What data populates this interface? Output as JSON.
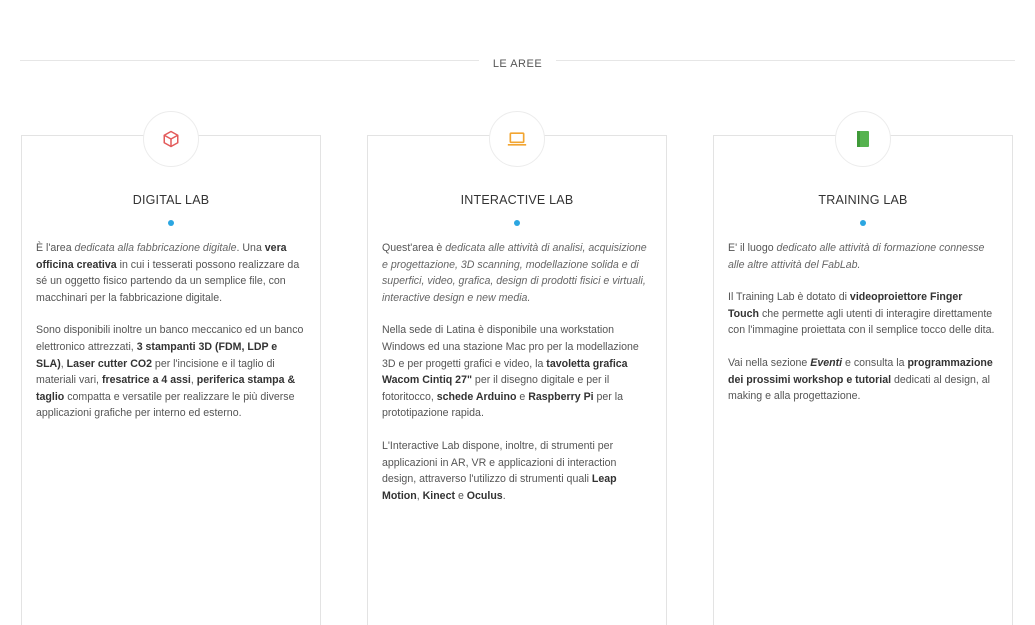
{
  "section": {
    "title": "LE AREE"
  },
  "colors": {
    "accent": "#2ba6e1",
    "cube_icon": "#e35a5a",
    "laptop_icon": "#f2a531",
    "book_icon": "#56b34f"
  },
  "cards": [
    {
      "icon": "cube-icon",
      "title": "DIGITAL LAB",
      "p1": {
        "s1": "È l'area ",
        "em1": "dedicata alla fabbricazione digitale",
        "s2": ". Una ",
        "b1": "vera officina creativa",
        "s3": " in cui i tesserati possono realizzare da sé un oggetto fisico partendo da un semplice file, con macchinari per la fabbricazione digitale."
      },
      "p2": {
        "s1": "Sono disponibili inoltre un banco meccanico ed un banco elettronico attrezzati, ",
        "b1": "3 stampanti 3D (FDM, LDP e SLA)",
        "s2": ", ",
        "b2": "Laser cutter CO2",
        "s3": " per l'incisione e il taglio di materiali vari, ",
        "b3": "fresatrice a 4 assi",
        "s4": ", ",
        "b4": "periferica stampa & taglio",
        "s5": " compatta e versatile per realizzare le più diverse applicazioni grafiche per interno ed esterno."
      }
    },
    {
      "icon": "laptop-icon",
      "title": "INTERACTIVE LAB",
      "p1": {
        "s1": "Quest'area è ",
        "em1": "dedicata alle attività di analisi, acquisizione e progettazione, 3D scanning, modellazione solida e di superfici, video, grafica, design di prodotti fisici e virtuali, interactive design e new media."
      },
      "p2": {
        "s1": "Nella sede di Latina è disponibile una workstation Windows ed una stazione Mac pro per la modellazione 3D e per progetti grafici e video, la ",
        "b1": "tavoletta grafica Wacom Cintiq 27\"",
        "s2": " per il disegno digitale e per il fotoritocco, ",
        "b2": "schede Arduino",
        "s3": " e ",
        "b3": "Raspberry Pi",
        "s4": " per la prototipazione rapida."
      },
      "p3": {
        "s1": "L'Interactive Lab dispone, inoltre, di strumenti per applicazioni in AR, VR e applicazioni di interaction design, attraverso l'utilizzo di strumenti quali ",
        "b1": "Leap Motion",
        "s2": ", ",
        "b2": "Kinect",
        "s3": " e ",
        "b3": "Oculus",
        "s4": "."
      }
    },
    {
      "icon": "book-icon",
      "title": "TRAINING LAB",
      "p1": {
        "s1": "E' il luogo ",
        "em1": "dedicato alle attività di formazione connesse alle altre attività del FabLab."
      },
      "p2": {
        "s1": "Il Training Lab è dotato di ",
        "b1": "videoproiettore Finger Touch",
        "s2": " che permette agli utenti di interagire direttamente con l'immagine proiettata con il semplice tocco delle dita."
      },
      "p3": {
        "s1": "Vai nella sezione ",
        "b1": "Eventi",
        "s2": " e consulta la ",
        "b2": "programmazione dei prossimi workshop e tutorial",
        "s3": " dedicati al design, al making e alla progettazione."
      }
    }
  ]
}
